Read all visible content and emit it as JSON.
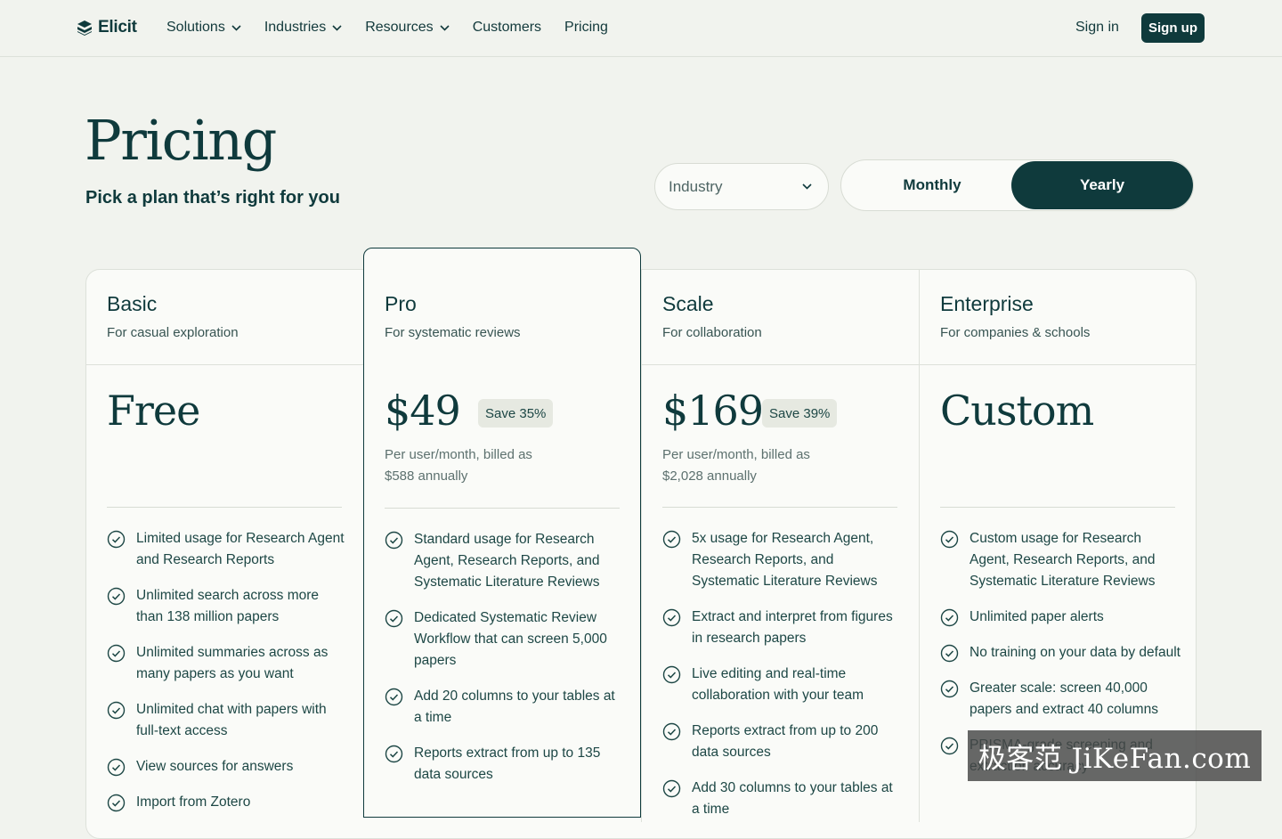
{
  "nav": {
    "logo_text": "Elicit",
    "items": [
      {
        "label": "Solutions",
        "has_menu": true
      },
      {
        "label": "Industries",
        "has_menu": true
      },
      {
        "label": "Resources",
        "has_menu": true
      },
      {
        "label": "Customers",
        "has_menu": false
      },
      {
        "label": "Pricing",
        "has_menu": false
      }
    ],
    "sign_in": "Sign in",
    "sign_up": "Sign up"
  },
  "header": {
    "title": "Pricing",
    "subtitle": "Pick a plan that’s right for you",
    "industry_select": "Industry",
    "toggle": {
      "monthly": "Monthly",
      "yearly": "Yearly",
      "selected": "Yearly"
    }
  },
  "plans": [
    {
      "name": "Basic",
      "tagline": "For casual exploration",
      "price": "Free",
      "save": "",
      "billing": "",
      "features": [
        "Limited usage for Research Agent and Research Reports",
        "Unlimited search across more than 138 million papers",
        "Unlimited summaries across as many papers as you want",
        "Unlimited chat with papers with full-text access",
        "View sources for answers",
        "Import from Zotero"
      ]
    },
    {
      "name": "Pro",
      "tagline": "For systematic reviews",
      "price": "$49",
      "save": "Save 35%",
      "billing": "Per user/month, billed as $588 annually",
      "features": [
        "Standard usage for Research Agent, Research Reports, and Systematic Literature Reviews",
        "Dedicated Systematic Review Workflow that can screen 5,000 papers",
        "Add 20 columns to your tables at a time",
        "Reports extract from up to 135 data sources"
      ]
    },
    {
      "name": "Scale",
      "tagline": "For collaboration",
      "price": "$169",
      "save": "Save 39%",
      "billing": "Per user/month, billed as $2,028 annually",
      "features": [
        "5x usage for Research Agent, Research Reports, and Systematic Literature Reviews",
        "Extract and interpret from figures in research papers",
        "Live editing and real-time collaboration with your team",
        "Reports extract from up to 200 data sources",
        "Add 30 columns to your tables at a time"
      ]
    },
    {
      "name": "Enterprise",
      "tagline": "For companies & schools",
      "price": "Custom",
      "save": "",
      "billing": "",
      "features": [
        "Custom usage for Research Agent, Research Reports, and Systematic Literature Reviews",
        "Unlimited paper alerts",
        "No training on your data by default",
        "Greater scale: screen 40,000 papers and extract 40 columns",
        "PRISMA-grade screening and extraction accuracy"
      ]
    }
  ],
  "watermark": "极客范 JiKeFan.com",
  "colors": {
    "brand": "#0f3a3c",
    "background": "#f1f3ee",
    "card": "#fafbf8",
    "badge": "#e6e9e1"
  }
}
